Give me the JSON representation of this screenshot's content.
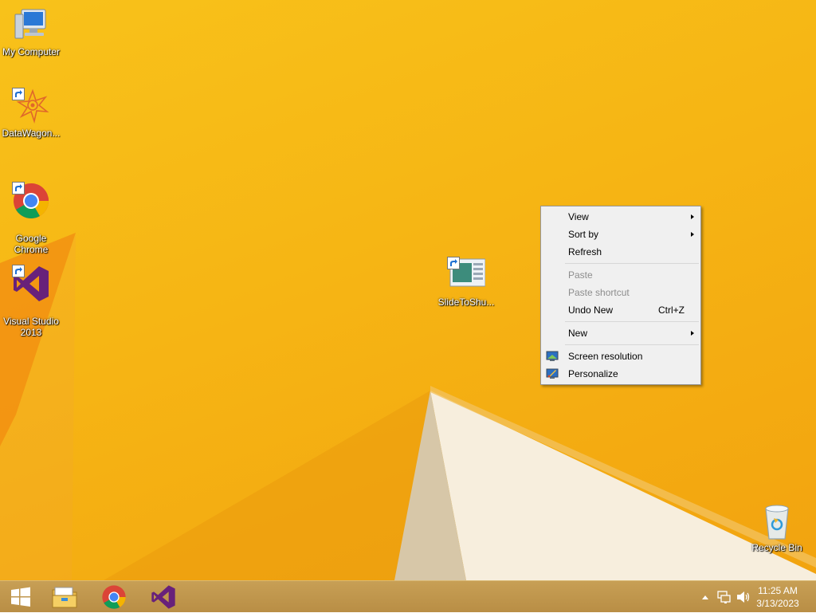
{
  "desktop": {
    "icons": [
      {
        "label": "My Computer",
        "icon": "computer-icon",
        "shortcut": false
      },
      {
        "label": "DataWagon...",
        "icon": "datawagon-icon",
        "shortcut": true
      },
      {
        "label": "Google\nChrome",
        "icon": "chrome-icon",
        "shortcut": true
      },
      {
        "label": "Visual Studio\n2013",
        "icon": "visual-studio-icon",
        "shortcut": true
      },
      {
        "label": "SlideToShu...",
        "icon": "slidetoshutdown-icon",
        "shortcut": true
      },
      {
        "label": "Recycle Bin",
        "icon": "recycle-bin-icon",
        "shortcut": false
      }
    ]
  },
  "context_menu": {
    "items": [
      {
        "label": "View",
        "submenu": true,
        "disabled": false
      },
      {
        "label": "Sort by",
        "submenu": true,
        "disabled": false
      },
      {
        "label": "Refresh",
        "disabled": false
      },
      {
        "label": "Paste",
        "disabled": true
      },
      {
        "label": "Paste shortcut",
        "disabled": true
      },
      {
        "label": "Undo New",
        "shortcut": "Ctrl+Z",
        "disabled": false
      },
      {
        "label": "New",
        "submenu": true,
        "disabled": false
      },
      {
        "label": "Screen resolution",
        "icon": "screen-resolution-icon",
        "disabled": false
      },
      {
        "label": "Personalize",
        "icon": "personalize-icon",
        "disabled": false
      }
    ]
  },
  "taskbar": {
    "pinned": [
      {
        "name": "start",
        "icon": "windows-start-icon"
      },
      {
        "name": "file-explorer",
        "icon": "file-explorer-icon"
      },
      {
        "name": "chrome",
        "icon": "chrome-icon"
      },
      {
        "name": "visual-studio",
        "icon": "visual-studio-icon"
      }
    ],
    "tray": {
      "time": "11:25 AM",
      "date": "3/13/2023"
    }
  },
  "colors": {
    "wallpaper": "#f6b514",
    "taskbar": "#c19850",
    "vs_purple": "#68217a"
  }
}
